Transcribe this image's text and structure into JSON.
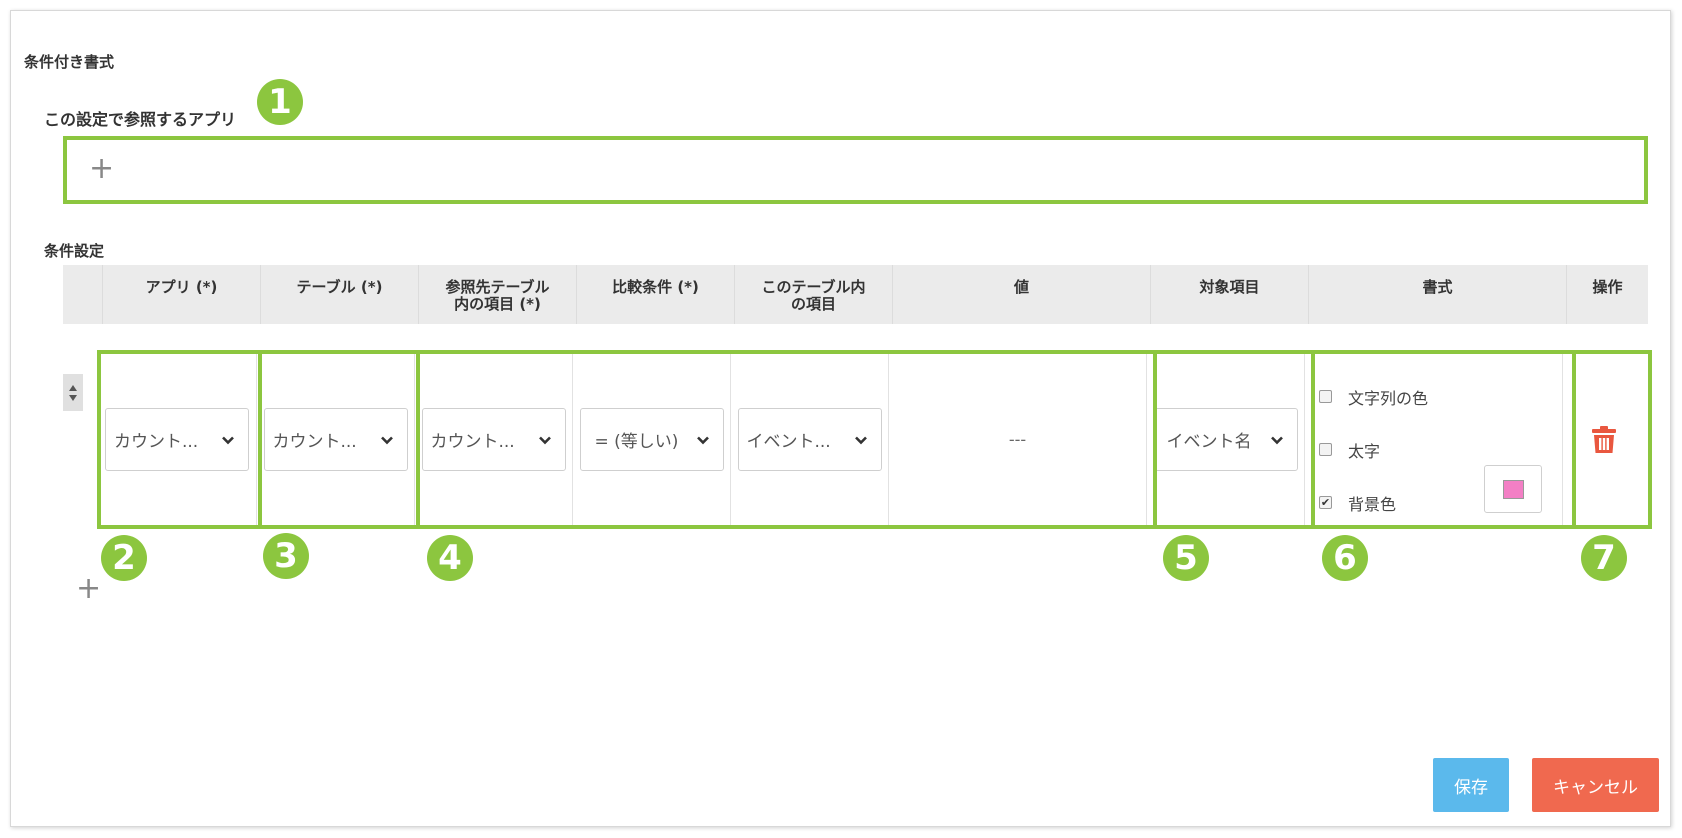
{
  "title": "条件付き書式",
  "ref_app_section": {
    "label": "この設定で参照するアプリ",
    "badge": "1"
  },
  "condition_section": {
    "label": "条件設定"
  },
  "table": {
    "headers": [
      "",
      "アプリ (*)",
      "テーブル (*)",
      "参照先テーブル\n内の項目 (*)",
      "比較条件 (*)",
      "このテーブル内\nの項目",
      "値",
      "対象項目",
      "書式",
      "操作"
    ]
  },
  "row": {
    "app_select": "カウント...",
    "table_select": "カウント...",
    "ref_field_select": "カウント...",
    "compare_select": "= (等しい)",
    "field_select": "イベント...",
    "value": "---",
    "target_select": "イベント名",
    "format_options": [
      {
        "label": "文字列の色",
        "checked": false
      },
      {
        "label": "太字",
        "checked": false
      },
      {
        "label": "背景色",
        "checked": true
      }
    ],
    "bg_color": "#f37fc5"
  },
  "badges": [
    "2",
    "3",
    "4",
    "5",
    "6",
    "7"
  ],
  "buttons": {
    "save": "保存",
    "cancel": "キャンセル"
  },
  "colors": {
    "highlight": "#8cc63f",
    "save": "#5bb9ec",
    "cancel": "#f0694f",
    "delete": "#e9573f"
  }
}
